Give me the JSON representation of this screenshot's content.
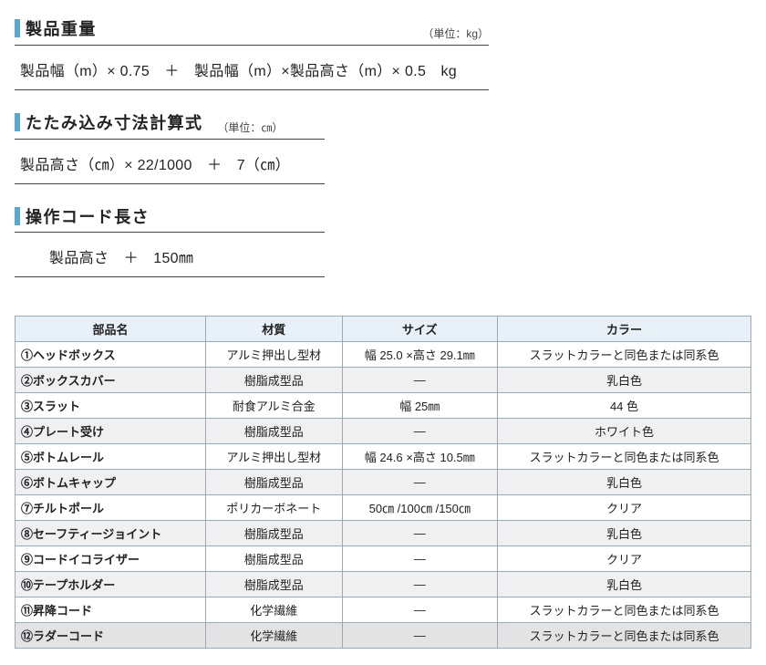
{
  "sections": [
    {
      "title": "製品重量",
      "unit": "（単位：kg）",
      "unit_pos": "right",
      "formula": "製品幅（m）× 0.75　＋　製品幅（m）×製品高さ（m）× 0.5　kg",
      "width": "w1",
      "pad": false
    },
    {
      "title": "たたみ込み寸法計算式",
      "unit": "（単位：㎝）",
      "unit_pos": "inline",
      "formula": "製品高さ（㎝）× 22/1000　＋　7（㎝）",
      "width": "med",
      "pad": false
    },
    {
      "title": "操作コード長さ",
      "unit": "",
      "unit_pos": "none",
      "formula": "製品高さ　＋　150㎜",
      "width": "short",
      "pad": true
    }
  ],
  "table": {
    "headers": [
      "部品名",
      "材質",
      "サイズ",
      "カラー"
    ],
    "enclosed_numbers": [
      "①",
      "②",
      "③",
      "④",
      "⑤",
      "⑥",
      "⑦",
      "⑧",
      "⑨",
      "⑩",
      "⑪",
      "⑫"
    ],
    "rows": [
      {
        "name": "ヘッドボックス",
        "material": "アルミ押出し型材",
        "size": "幅 25.0 ×高さ 29.1㎜",
        "color": "スラットカラーと同色または同系色",
        "cls": "even"
      },
      {
        "name": "ボックスカバー",
        "material": "樹脂成型品",
        "size": "―",
        "color": "乳白色",
        "cls": "odd"
      },
      {
        "name": "スラット",
        "material": "耐食アルミ合金",
        "size": "幅 25㎜",
        "color": "44 色",
        "cls": "even"
      },
      {
        "name": "プレート受け",
        "material": "樹脂成型品",
        "size": "―",
        "color": "ホワイト色",
        "cls": "odd"
      },
      {
        "name": "ボトムレール",
        "material": "アルミ押出し型材",
        "size": "幅 24.6 ×高さ 10.5㎜",
        "color": "スラットカラーと同色または同系色",
        "cls": "even"
      },
      {
        "name": "ボトムキャップ",
        "material": "樹脂成型品",
        "size": "―",
        "color": "乳白色",
        "cls": "odd"
      },
      {
        "name": "チルトポール",
        "material": "ポリカーボネート",
        "size": "50㎝ /100㎝ /150㎝",
        "color": "クリア",
        "cls": "even"
      },
      {
        "name": "セーフティージョイント",
        "material": "樹脂成型品",
        "size": "―",
        "color": "乳白色",
        "cls": "odd"
      },
      {
        "name": "コードイコライザー",
        "material": "樹脂成型品",
        "size": "―",
        "color": "クリア",
        "cls": "even"
      },
      {
        "name": "テープホルダー",
        "material": "樹脂成型品",
        "size": "―",
        "color": "乳白色",
        "cls": "odd"
      },
      {
        "name": "昇降コード",
        "material": "化学繊維",
        "size": "―",
        "color": "スラットカラーと同色または同系色",
        "cls": "even"
      },
      {
        "name": "ラダーコード",
        "material": "化学繊維",
        "size": "―",
        "color": "スラットカラーと同色または同系色",
        "cls": "sel"
      }
    ]
  }
}
